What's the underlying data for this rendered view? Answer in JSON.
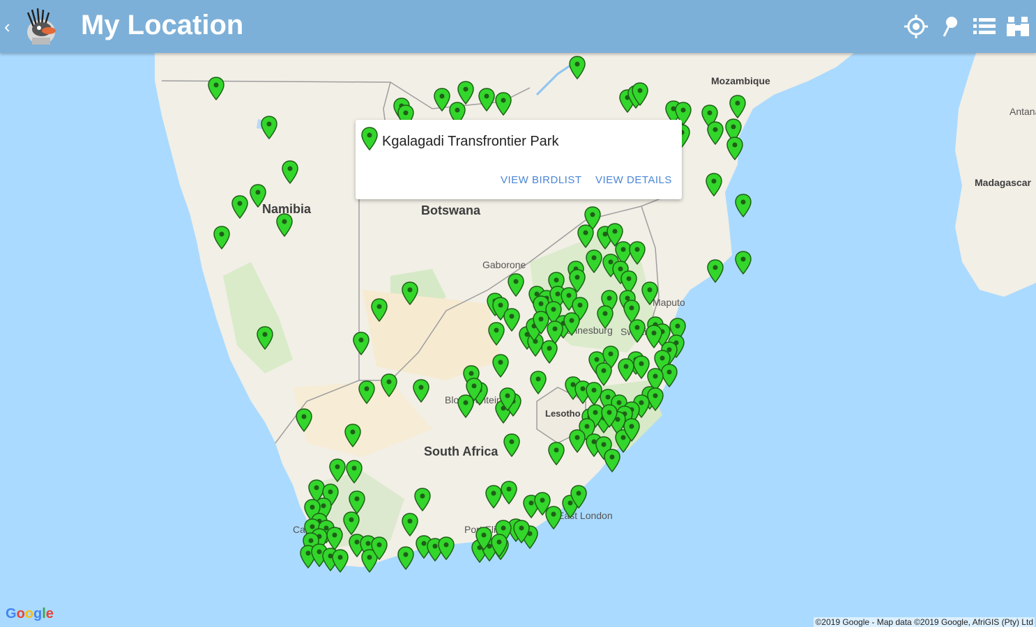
{
  "app": {
    "title": "My Location"
  },
  "toolbar": {
    "icons": [
      "back-icon",
      "app-logo",
      "locate-icon",
      "pin-icon",
      "list-icon",
      "binoculars-icon"
    ],
    "color": "#7db0d8"
  },
  "map": {
    "labels": {
      "namibia": "Namibia",
      "botswana": "Botswana",
      "south_africa": "South Africa",
      "mozambique": "Mozambique",
      "madagascar": "Madagascar",
      "lesotho": "Lesotho",
      "gaborone": "Gaborone",
      "maputo": "Maputo",
      "bloemfontein": "Bloemfontein",
      "east_london": "East London",
      "port_elizabeth": "Port Elizabeth",
      "cape_town": "Cape Town",
      "antananarivo": "Antananarivo",
      "johannesburg": "Johannesburg",
      "swaziland": "Swaziland"
    },
    "pin_color": "#33d62b",
    "land_color": "#f2efe6",
    "water_color": "#aadaff"
  },
  "info_window": {
    "name": "Kgalagadi Transfrontier Park",
    "view_birdlist": "VIEW BIRDLIST",
    "view_details": "VIEW DETAILS"
  },
  "footer": {
    "google": "Google",
    "attribution": "©2019 Google - Map data ©2019 Google, AfriGIS (Pty) Ltd"
  }
}
